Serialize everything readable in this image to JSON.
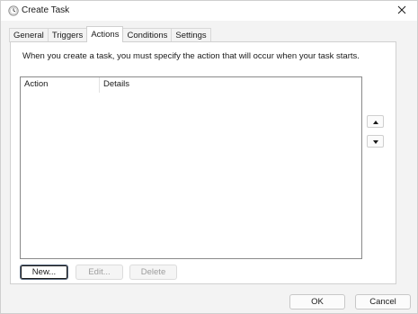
{
  "window": {
    "title": "Create Task"
  },
  "icons": {
    "app": "task-scheduler-icon",
    "close": "close-icon",
    "up": "move-up-icon",
    "down": "move-down-icon"
  },
  "tabs": [
    {
      "label": "General"
    },
    {
      "label": "Triggers"
    },
    {
      "label": "Actions",
      "active": true
    },
    {
      "label": "Conditions"
    },
    {
      "label": "Settings"
    }
  ],
  "actions_tab": {
    "description": "When you create a task, you must specify the action that will occur when your task starts.",
    "columns": [
      "Action",
      "Details"
    ],
    "rows": [],
    "buttons": {
      "new": "New...",
      "edit": "Edit...",
      "delete": "Delete"
    }
  },
  "footer": {
    "ok": "OK",
    "cancel": "Cancel"
  },
  "colors": {
    "window_bg": "#f3f3f3",
    "panel_bg": "#ffffff",
    "accent": "#0067c0"
  }
}
